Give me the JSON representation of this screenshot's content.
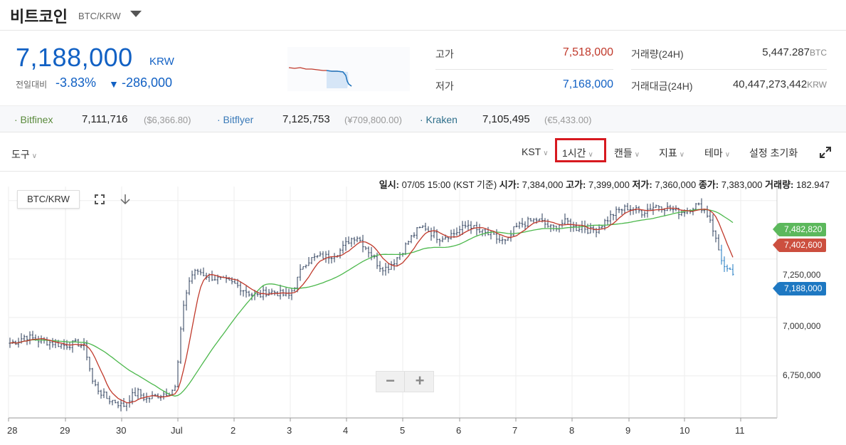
{
  "header": {
    "coin_name": "비트코인",
    "pair": "BTC/KRW"
  },
  "price": {
    "current": "7,188,000",
    "unit": "KRW",
    "change_label": "전일대비",
    "change_rate": "-3.83%",
    "change_arrow": "▼",
    "change_amount": "-286,000"
  },
  "stats": {
    "high_label": "고가",
    "high_value": "7,518,000",
    "low_label": "저가",
    "low_value": "7,168,000",
    "volume_label": "거래량(24H)",
    "volume_value": "5,447.287",
    "volume_unit": "BTC",
    "amount_label": "거래대금(24H)",
    "amount_value": "40,447,273,442",
    "amount_unit": "KRW"
  },
  "exchanges": [
    {
      "name": "· Bitfinex",
      "price": "7,111,716",
      "sub": "($6,366.80)",
      "color": "#5a8a3c"
    },
    {
      "name": "· Bitflyer",
      "price": "7,125,753",
      "sub": "(¥709,800.00)",
      "color": "#3a7ab8"
    },
    {
      "name": "· Kraken",
      "price": "7,105,495",
      "sub": "(€5,433.00)",
      "color": "#2d6e8a"
    }
  ],
  "toolbar": {
    "tools": "도구",
    "timezone": "KST",
    "interval": "1시간",
    "candles": "캔들",
    "indicators": "지표",
    "theme": "테마",
    "reset": "설정 초기화"
  },
  "ohlc_info": {
    "date_label": "일시:",
    "date_value": "07/05 15:00 (KST 기준)",
    "open_label": "시가:",
    "open_value": "7,384,000",
    "high_label": "고가:",
    "high_value": "7,399,000",
    "low_label": "저가:",
    "low_value": "7,360,000",
    "close_label": "종가:",
    "close_value": "7,383,000",
    "vol_label": "거래량:",
    "vol_value": "182.947"
  },
  "chart": {
    "pair_button": "BTC/KRW",
    "zoom_minus": "−",
    "zoom_plus": "+",
    "tags": {
      "green": "7,482,820",
      "red": "7,402,600",
      "blue": "7,188,000"
    },
    "yticks": [
      "7,250,000",
      "7,000,000",
      "6,750,000"
    ],
    "xticks": [
      "28",
      "29",
      "30",
      "Jul",
      "2",
      "3",
      "4",
      "5",
      "6",
      "7",
      "8",
      "9",
      "10",
      "11"
    ],
    "colors": {
      "candle": "#2b3c5a",
      "candle_last": "#1e78c2",
      "ma_short": "#c0392b",
      "ma_long": "#4cb84c",
      "grid": "#eeeeee"
    },
    "ylim": [
      6570000,
      7560000
    ],
    "price_path": [
      6890000,
      6900000,
      6920000,
      6910000,
      6900000,
      6895000,
      6890000,
      6880000,
      6885000,
      6890000,
      6870000,
      6720000,
      6680000,
      6650000,
      6640000,
      6620000,
      6660000,
      6680000,
      6650000,
      6660000,
      6670000,
      6680000,
      6700000,
      7050000,
      7180000,
      7200000,
      7180000,
      7170000,
      7160000,
      7150000,
      7140000,
      7120000,
      7100000,
      7090000,
      7110000,
      7110000,
      7100000,
      7090000,
      7150000,
      7230000,
      7250000,
      7260000,
      7260000,
      7270000,
      7290000,
      7330000,
      7350000,
      7310000,
      7270000,
      7220000,
      7210000,
      7240000,
      7280000,
      7330000,
      7370000,
      7390000,
      7360000,
      7340000,
      7350000,
      7360000,
      7380000,
      7400000,
      7370000,
      7360000,
      7350000,
      7330000,
      7320000,
      7380000,
      7400000,
      7410000,
      7420000,
      7400000,
      7380000,
      7400000,
      7410000,
      7380000,
      7390000,
      7370000,
      7380000,
      7410000,
      7440000,
      7460000,
      7470000,
      7460000,
      7450000,
      7470000,
      7480000,
      7470000,
      7460000,
      7450000,
      7460000,
      7480000,
      7470000,
      7420000,
      7300000,
      7200000,
      7188000
    ]
  }
}
